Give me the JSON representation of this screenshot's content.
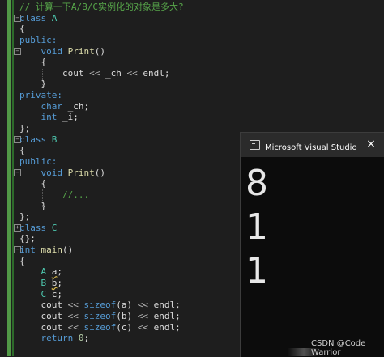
{
  "editor": {
    "lines": [
      [
        {
          "t": "// 计算一下A/B/C实例化的对象是多大?",
          "c": "cm"
        }
      ],
      [
        {
          "t": "class ",
          "c": "kw"
        },
        {
          "t": "A",
          "c": "ty"
        }
      ],
      [
        {
          "t": "{",
          "c": "id"
        }
      ],
      [
        {
          "t": "public:",
          "c": "kw"
        }
      ],
      [
        {
          "t": "    void ",
          "c": "kw"
        },
        {
          "t": "Print",
          "c": "fn"
        },
        {
          "t": "()",
          "c": "id"
        }
      ],
      [
        {
          "t": "    {",
          "c": "id"
        }
      ],
      [
        {
          "t": "        cout ",
          "c": "id"
        },
        {
          "t": "<< ",
          "c": "op"
        },
        {
          "t": "_ch ",
          "c": "id"
        },
        {
          "t": "<< ",
          "c": "op"
        },
        {
          "t": "endl;",
          "c": "id"
        }
      ],
      [
        {
          "t": "    }",
          "c": "id"
        }
      ],
      [
        {
          "t": "private:",
          "c": "kw"
        }
      ],
      [
        {
          "t": "    char ",
          "c": "kw"
        },
        {
          "t": "_ch;",
          "c": "id"
        }
      ],
      [
        {
          "t": "    int ",
          "c": "kw"
        },
        {
          "t": "_i;",
          "c": "id"
        }
      ],
      [
        {
          "t": "};",
          "c": "id"
        }
      ],
      [
        {
          "t": "class ",
          "c": "kw"
        },
        {
          "t": "B",
          "c": "ty"
        }
      ],
      [
        {
          "t": "{",
          "c": "id"
        }
      ],
      [
        {
          "t": "public:",
          "c": "kw"
        }
      ],
      [
        {
          "t": "    void ",
          "c": "kw"
        },
        {
          "t": "Print",
          "c": "fn"
        },
        {
          "t": "()",
          "c": "id"
        }
      ],
      [
        {
          "t": "    {",
          "c": "id"
        }
      ],
      [
        {
          "t": "        //...",
          "c": "cm"
        }
      ],
      [
        {
          "t": "    }",
          "c": "id"
        }
      ],
      [
        {
          "t": "};",
          "c": "id"
        }
      ],
      [
        {
          "t": "class ",
          "c": "kw"
        },
        {
          "t": "C",
          "c": "ty"
        }
      ],
      [
        {
          "t": "{};",
          "c": "id"
        }
      ],
      [
        {
          "t": "int ",
          "c": "kw"
        },
        {
          "t": "main",
          "c": "fn"
        },
        {
          "t": "()",
          "c": "id"
        }
      ],
      [
        {
          "t": "{",
          "c": "id"
        }
      ],
      [
        {
          "t": "    A ",
          "c": "ty"
        },
        {
          "t": "a",
          "c": "id",
          "sq": true
        },
        {
          "t": ";",
          "c": "id"
        }
      ],
      [
        {
          "t": "    B ",
          "c": "ty"
        },
        {
          "t": "b",
          "c": "id",
          "sq": true
        },
        {
          "t": ";",
          "c": "id"
        }
      ],
      [
        {
          "t": "    C ",
          "c": "ty"
        },
        {
          "t": "c;",
          "c": "id"
        }
      ],
      [
        {
          "t": "    cout ",
          "c": "id"
        },
        {
          "t": "<< ",
          "c": "op"
        },
        {
          "t": "sizeof",
          "c": "kw"
        },
        {
          "t": "(a) ",
          "c": "id"
        },
        {
          "t": "<< ",
          "c": "op"
        },
        {
          "t": "endl;",
          "c": "id"
        }
      ],
      [
        {
          "t": "    cout ",
          "c": "id"
        },
        {
          "t": "<< ",
          "c": "op"
        },
        {
          "t": "sizeof",
          "c": "kw"
        },
        {
          "t": "(b) ",
          "c": "id"
        },
        {
          "t": "<< ",
          "c": "op"
        },
        {
          "t": "endl;",
          "c": "id"
        }
      ],
      [
        {
          "t": "    cout ",
          "c": "id"
        },
        {
          "t": "<< ",
          "c": "op"
        },
        {
          "t": "sizeof",
          "c": "kw"
        },
        {
          "t": "(c) ",
          "c": "id"
        },
        {
          "t": "<< ",
          "c": "op"
        },
        {
          "t": "endl;",
          "c": "id"
        }
      ],
      [
        {
          "t": "    return ",
          "c": "kw"
        },
        {
          "t": "0",
          "c": "num"
        },
        {
          "t": ";",
          "c": "id"
        }
      ]
    ]
  },
  "console": {
    "title": "Microsoft Visual Studio 调试控制台",
    "close_glyph": "×",
    "output": [
      "8",
      "1",
      "1"
    ]
  },
  "watermark": "CSDN @Code Warrior",
  "colors": {
    "comment": "#57a64a",
    "keyword": "#569cd6",
    "type": "#4ec9b0",
    "function": "#dcdcaa",
    "background": "#1e1e1e",
    "console_bg": "#0c0c0c"
  }
}
